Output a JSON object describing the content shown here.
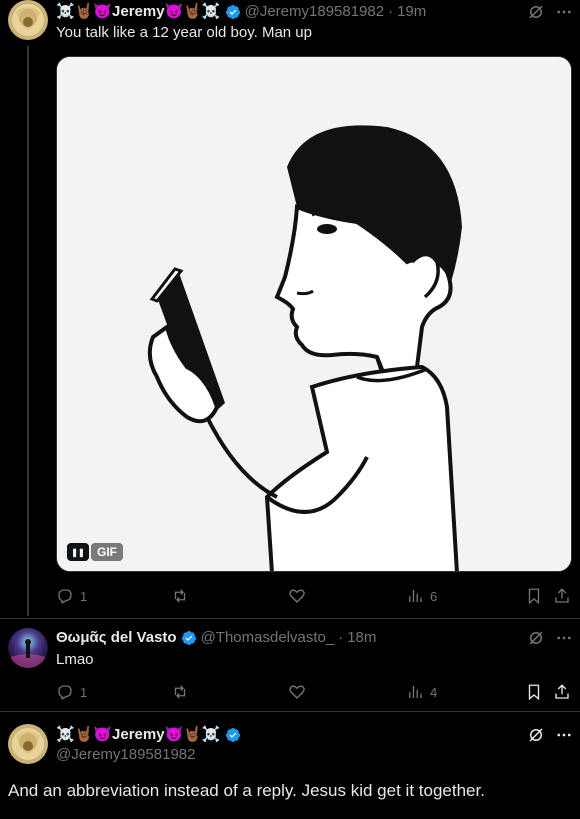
{
  "tweets": [
    {
      "name_prefix": "☠️🤘🏾😈",
      "name": "Jeremy",
      "name_suffix": "😈🤘🏾☠️",
      "handle": "@Jeremy189581982",
      "time": "19m",
      "text": "You talk like a 12 year old boy.  Man up",
      "media_badge": "GIF",
      "replies": "1",
      "views": "6"
    },
    {
      "name": "Θωμᾶς del Vasto",
      "handle": "@Thomasdelvasto_",
      "time": "18m",
      "text": "Lmao",
      "replies": "1",
      "views": "4"
    },
    {
      "name_prefix": "☠️🤘🏾😈",
      "name": "Jeremy",
      "name_suffix": "😈🤘🏾☠️",
      "handle": "@Jeremy189581982",
      "text": "And an abbreviation instead of a reply. Jesus kid get it together."
    }
  ],
  "colors": {
    "background": "#000000",
    "verified": "#1d9bf0",
    "muted": "#71767b",
    "text": "#e7e9ea"
  }
}
